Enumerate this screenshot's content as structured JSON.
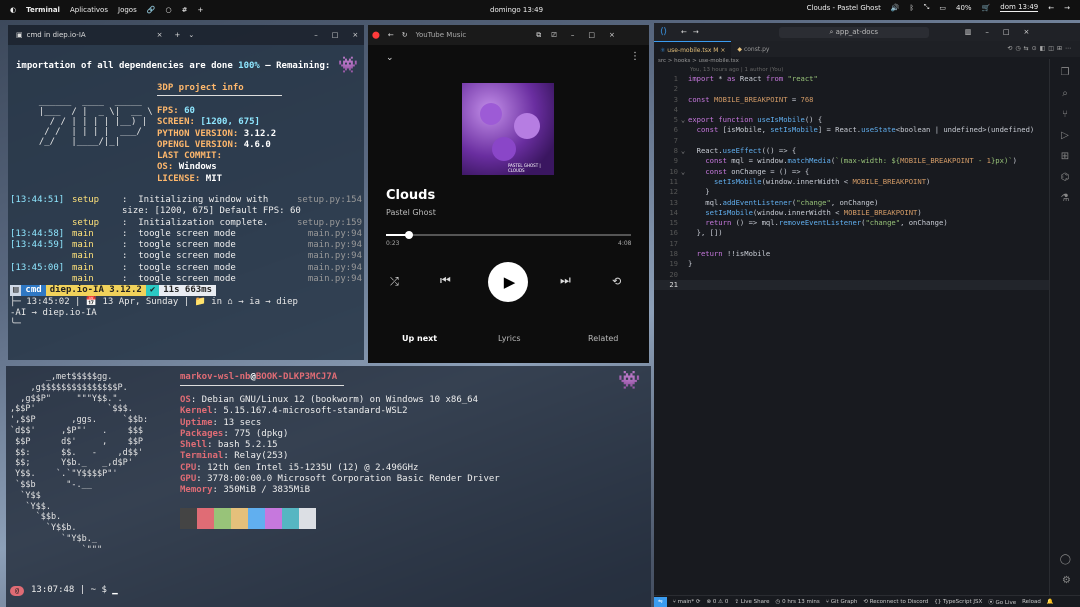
{
  "topbar": {
    "apps": [
      "Terminal",
      "Aplicativos",
      "Jogos"
    ],
    "clock": "domingo 13:49",
    "now_playing": "Clouds - Pastel Ghost",
    "battery": "40%",
    "clock2": "dom 13:49"
  },
  "term1": {
    "title": "cmd in diep.io-IA",
    "head_pre": "importation of all dependencies are done ",
    "head_pct": "100%",
    "head_post": " — Remaining:",
    "info_title": "3DP project info",
    "ascii": [
      "  ______  ____  _____",
      "  |___  / |  _ \\|  __ \\",
      "    / / | | | | |__) |",
      "   / /  | | | |  ___/",
      "  /_/   |____/|_|"
    ],
    "info": [
      {
        "k": "FPS: ",
        "v": "60"
      },
      {
        "k": "SCREEN: ",
        "v": "[1200, 675]"
      },
      {
        "k": "PYTHON VERSION: ",
        "v": "3.12.2"
      },
      {
        "k": "OPENGL VERSION: ",
        "v": "4.6.0"
      },
      {
        "k": "LAST COMMIT:",
        "v": ""
      },
      {
        "k": "OS: ",
        "v": "Windows"
      },
      {
        "k": "LICENSE: ",
        "v": "MIT"
      }
    ],
    "logs": [
      {
        "t": "[13:44:51]",
        "s": "setup",
        "m": ":  Initializing window with",
        "f": "setup.py:154"
      },
      {
        "t": "",
        "s": "",
        "m": "size: [1200, 675] Default FPS: 60",
        "f": ""
      },
      {
        "t": "",
        "s": "setup",
        "m": ":  Initialization complete.",
        "f": "setup.py:159"
      },
      {
        "t": "[13:44:58]",
        "s": "main",
        "m": ":  toogle screen mode",
        "f": "main.py:94"
      },
      {
        "t": "[13:44:59]",
        "s": "main",
        "m": ":  toogle screen mode",
        "f": "main.py:94"
      },
      {
        "t": "",
        "s": "main",
        "m": ":  toogle screen mode",
        "f": "main.py:94"
      },
      {
        "t": "[13:45:00]",
        "s": "main",
        "m": ":  toogle screen mode",
        "f": "main.py:94"
      },
      {
        "t": "",
        "s": "main",
        "m": ":  toogle screen mode",
        "f": "main.py:94"
      }
    ],
    "prompt": {
      "seg1": "cmd",
      "seg2": "diep.io-IA 3.12.2",
      "seg3": "11s 663ms",
      "l2": "13:45:02 | 📅 13 Apr, Sunday | 📁 in ⌂ → ia → diep",
      "l3": "-AI → diep.io-IA"
    }
  },
  "yt": {
    "app": "YouTube Music",
    "song": "Clouds",
    "artist": "Pastel Ghost",
    "elapsed": "0:23",
    "total": "4:08",
    "progress": 0.093,
    "tabs": [
      "Up next",
      "Lyrics",
      "Related"
    ],
    "cover_text": "PASTEL GHOST | CLOUDS"
  },
  "vscode": {
    "search": "app_at-docs",
    "tabs": [
      {
        "label": "use-mobile.tsx",
        "badge": "M"
      },
      {
        "label": "const.py"
      }
    ],
    "breadcrumb": "src > hooks > use-mobile.tsx",
    "blame": "You, 13 hours ago | 1 author (You)",
    "status": {
      "branch": "main*",
      "errors": "0",
      "warnings": "0",
      "liveshare": "Live Share",
      "time": "0 hrs 13 mins",
      "graph": "Git Graph",
      "discord": "Reconnect to Discord",
      "lang": "TypeScript JSX",
      "golive": "Go Live",
      "reload": "Reload"
    },
    "lines": [
      "import * as React from \"react\"",
      "",
      "const MOBILE_BREAKPOINT = 768",
      "",
      "export function useIsMobile() {",
      "  const [isMobile, setIsMobile] = React.useState<boolean | undefined>(undefined)",
      "",
      "  React.useEffect(() => {",
      "    const mql = window.matchMedia(`(max-width: ${MOBILE_BREAKPOINT - 1}px)`)",
      "    const onChange = () => {",
      "      setIsMobile(window.innerWidth < MOBILE_BREAKPOINT)",
      "    }",
      "    mql.addEventListener(\"change\", onChange)",
      "    setIsMobile(window.innerWidth < MOBILE_BREAKPOINT)",
      "    return () => mql.removeEventListener(\"change\", onChange)",
      "  }, [])",
      "",
      "  return !!isMobile",
      "}",
      "",
      ""
    ]
  },
  "neofetch": {
    "user": "markov-wsl-nb",
    "at": "@",
    "host": "BOOK-DLKP3MCJ7A",
    "rows": [
      {
        "k": "OS",
        "v": ": Debian GNU/Linux 12 (bookworm) on Windows 10 x86_64"
      },
      {
        "k": "Kernel",
        "v": ": 5.15.167.4-microsoft-standard-WSL2"
      },
      {
        "k": "Uptime",
        "v": ": 13 secs"
      },
      {
        "k": "Packages",
        "v": ": 775 (dpkg)"
      },
      {
        "k": "Shell",
        "v": ": bash 5.2.15"
      },
      {
        "k": "Terminal",
        "v": ": Relay(253)"
      },
      {
        "k": "CPU",
        "v": ": 12th Gen Intel i5-1235U (12) @ 2.496GHz"
      },
      {
        "k": "GPU",
        "v": ": 3778:00:00.0 Microsoft Corporation Basic Render Driver"
      },
      {
        "k": "Memory",
        "v": ": 350MiB / 3835MiB"
      }
    ],
    "logo": [
      "       _,met$$$$$gg.",
      "    ,g$$$$$$$$$$$$$$$P.",
      "  ,g$$P\"     \"\"\"Y$$.\".",
      ",$$P'              `$$$.",
      "',$$P       ,ggs.     `$$b:",
      "`d$$'     ,$P\"'   .    $$$",
      " $$P      d$'     ,    $$P",
      " $$:      $$.   -    ,d$$'",
      " $$;      Y$b._   _,d$P'",
      " Y$$.    `.`\"Y$$$$P\"'",
      " `$$b      \"-.__",
      "  `Y$$",
      "   `Y$$.",
      "     `$$b.",
      "       `Y$$b.",
      "          `\"Y$b._",
      "              `\"\"\""
    ],
    "palette": [
      "#444444",
      "#e06c75",
      "#98c379",
      "#e5c07b",
      "#61afef",
      "#c678dd",
      "#56b6c2",
      "#dcdfe4"
    ],
    "prompt": "13:07:48 | ~ $ "
  }
}
